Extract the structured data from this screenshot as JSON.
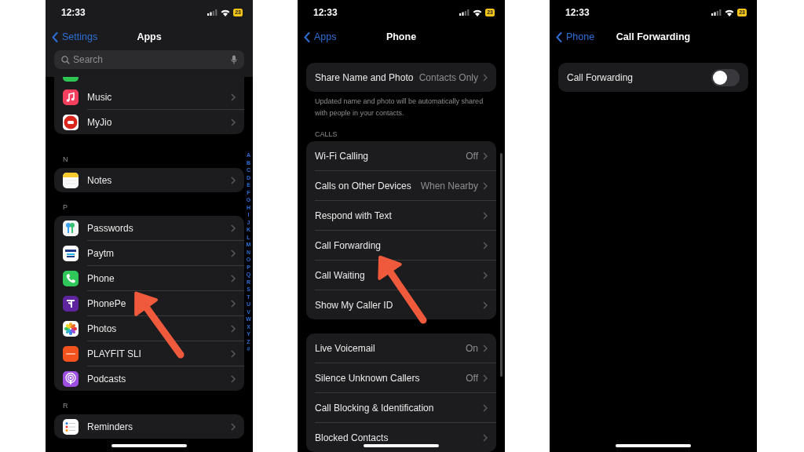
{
  "screens": [
    {
      "status": {
        "time": "12:33",
        "battery": "23"
      },
      "nav": {
        "back": "Settings",
        "title": "Apps"
      },
      "search": {
        "placeholder": "Search"
      },
      "sections": [
        {
          "clipped_row": true,
          "rows": [
            {
              "kind": "app",
              "label": "Music"
            },
            {
              "kind": "app",
              "label": "MyJio"
            }
          ]
        },
        {
          "header": "N",
          "rows": [
            {
              "kind": "app",
              "label": "Notes"
            }
          ]
        },
        {
          "header": "P",
          "rows": [
            {
              "kind": "app",
              "label": "Passwords"
            },
            {
              "kind": "app",
              "label": "Paytm"
            },
            {
              "kind": "app",
              "label": "Phone"
            },
            {
              "kind": "app",
              "label": "PhonePe"
            },
            {
              "kind": "app",
              "label": "Photos"
            },
            {
              "kind": "app",
              "label": "PLAYFIT SLI"
            },
            {
              "kind": "app",
              "label": "Podcasts"
            }
          ]
        },
        {
          "header": "R",
          "rows": [
            {
              "kind": "app",
              "label": "Reminders"
            }
          ]
        }
      ],
      "index": [
        "A",
        "B",
        "C",
        "D",
        "E",
        "F",
        "G",
        "H",
        "I",
        "J",
        "K",
        "L",
        "M",
        "N",
        "O",
        "P",
        "Q",
        "R",
        "S",
        "T",
        "U",
        "V",
        "W",
        "X",
        "Y",
        "Z",
        "#"
      ]
    },
    {
      "status": {
        "time": "12:33",
        "battery": "23"
      },
      "nav": {
        "back": "Apps",
        "title": "Phone"
      },
      "sections": [
        {
          "rows": [
            {
              "kind": "link",
              "label": "Share Name and Photo",
              "value": "Contacts Only"
            }
          ],
          "footer": "Updated name and photo will be automatically shared with people in your contacts."
        },
        {
          "header": "CALLS",
          "rows": [
            {
              "kind": "link",
              "label": "Wi-Fi Calling",
              "value": "Off"
            },
            {
              "kind": "link",
              "label": "Calls on Other Devices",
              "value": "When Nearby"
            },
            {
              "kind": "link",
              "label": "Respond with Text"
            },
            {
              "kind": "link",
              "label": "Call Forwarding"
            },
            {
              "kind": "link",
              "label": "Call Waiting"
            },
            {
              "kind": "link",
              "label": "Show My Caller ID"
            }
          ]
        },
        {
          "rows": [
            {
              "kind": "link",
              "label": "Live Voicemail",
              "value": "On"
            },
            {
              "kind": "link",
              "label": "Silence Unknown Callers",
              "value": "Off"
            },
            {
              "kind": "link",
              "label": "Call Blocking & Identification"
            },
            {
              "kind": "link",
              "label": "Blocked Contacts"
            }
          ]
        }
      ]
    },
    {
      "status": {
        "time": "12:33",
        "battery": "23"
      },
      "nav": {
        "back": "Phone",
        "title": "Call Forwarding"
      },
      "sections": [
        {
          "rows": [
            {
              "kind": "toggle",
              "label": "Call Forwarding",
              "on": false
            }
          ]
        }
      ]
    }
  ]
}
